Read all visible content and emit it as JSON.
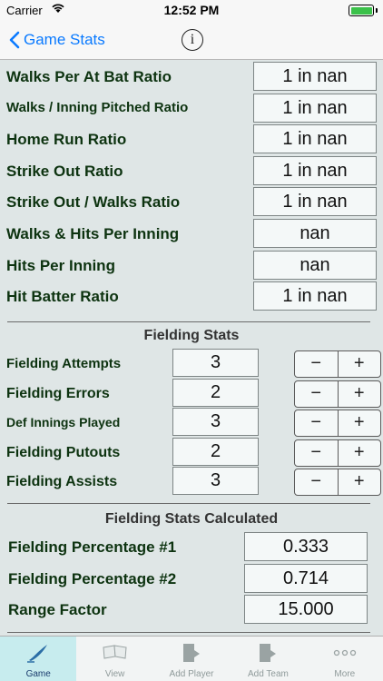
{
  "status": {
    "carrier": "Carrier",
    "time": "12:52 PM"
  },
  "nav": {
    "back_label": "Game Stats",
    "info_label": "i"
  },
  "ratios": [
    {
      "label": "Walks Per At Bat Ratio",
      "value": "1 in nan"
    },
    {
      "label": "Walks / Inning Pitched Ratio",
      "value": "1 in nan"
    },
    {
      "label": "Home Run Ratio",
      "value": "1 in nan"
    },
    {
      "label": "Strike Out Ratio",
      "value": "1 in nan"
    },
    {
      "label": "Strike Out / Walks Ratio",
      "value": "1 in nan"
    },
    {
      "label": "Walks & Hits Per Inning",
      "value": "nan"
    },
    {
      "label": "Hits Per Inning",
      "value": "nan"
    },
    {
      "label": "Hit Batter Ratio",
      "value": "1 in nan"
    }
  ],
  "fielding": {
    "title": "Fielding Stats",
    "rows": [
      {
        "label": "Fielding Attempts",
        "value": "3"
      },
      {
        "label": "Fielding Errors",
        "value": "2"
      },
      {
        "label": "Def Innings Played",
        "value": "3"
      },
      {
        "label": "Fielding Putouts",
        "value": "2"
      },
      {
        "label": "Fielding Assists",
        "value": "3"
      }
    ],
    "minus": "−",
    "plus": "+"
  },
  "calculated": {
    "title": "Fielding Stats Calculated",
    "rows": [
      {
        "label": "Fielding Percentage #1",
        "value": "0.333"
      },
      {
        "label": "Fielding Percentage #2",
        "value": "0.714"
      },
      {
        "label": "Range Factor",
        "value": "15.000"
      }
    ]
  },
  "tabs": [
    {
      "label": "Game",
      "icon": "pen-icon",
      "active": true
    },
    {
      "label": "View",
      "icon": "book-icon",
      "active": false
    },
    {
      "label": "Add Player",
      "icon": "add-player-icon",
      "active": false
    },
    {
      "label": "Add Team",
      "icon": "add-team-icon",
      "active": false
    },
    {
      "label": "More",
      "icon": "more-icon",
      "active": false
    }
  ]
}
